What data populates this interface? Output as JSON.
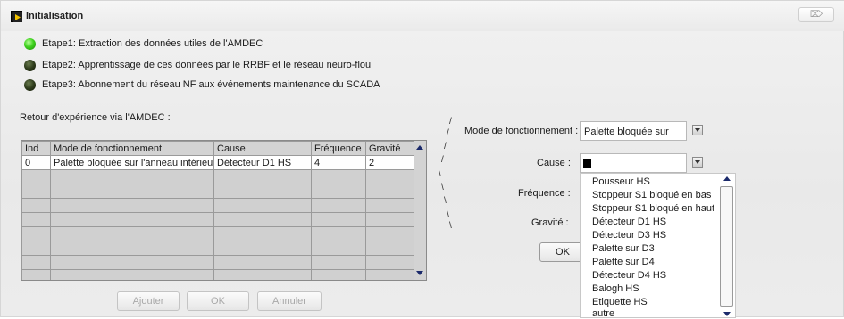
{
  "window": {
    "title": "Initialisation",
    "close_glyph": "⌦"
  },
  "steps": [
    {
      "label": "Etape1: Extraction des données utiles de l'AMDEC",
      "status": "on"
    },
    {
      "label": "Etape2: Apprentissage de ces données par le RRBF et le réseau neuro-flou",
      "status": "off"
    },
    {
      "label": "Etape3: Abonnement du réseau NF aux événements maintenance du SCADA",
      "status": "off"
    }
  ],
  "retour_label": "Retour d'expérience via l'AMDEC :",
  "table": {
    "columns": [
      "Ind",
      "Mode de fonctionnement",
      "Cause",
      "Fréquence",
      "Gravité"
    ],
    "rows": [
      [
        "0",
        "Palette bloquée sur l'anneau intérieur",
        "Détecteur D1 HS",
        "4",
        "2"
      ]
    ]
  },
  "buttons": {
    "ajouter": "Ajouter",
    "ok": "OK",
    "annuler": "Annuler",
    "form_ok": "OK"
  },
  "form": {
    "mode_label": "Mode de fonctionnement :",
    "mode_value": "Palette bloquée sur",
    "cause_label": "Cause :",
    "frequence_label": "Fréquence :",
    "gravite_label": "Gravité :"
  },
  "dropdown": {
    "items": [
      "Pousseur HS",
      "Stoppeur S1 bloqué en bas",
      "Stoppeur S1 bloqué en haut",
      "Détecteur D1 HS",
      "Détecteur D3 HS",
      "Palette sur D3",
      "Palette sur D4",
      "Détecteur D4 HS",
      "Balogh HS",
      "Etiquette HS",
      "autre"
    ]
  },
  "colors": {
    "led_on": "#3fd21e",
    "led_off": "#2e3c1c",
    "scroll_arrow": "#1b2a6b"
  }
}
